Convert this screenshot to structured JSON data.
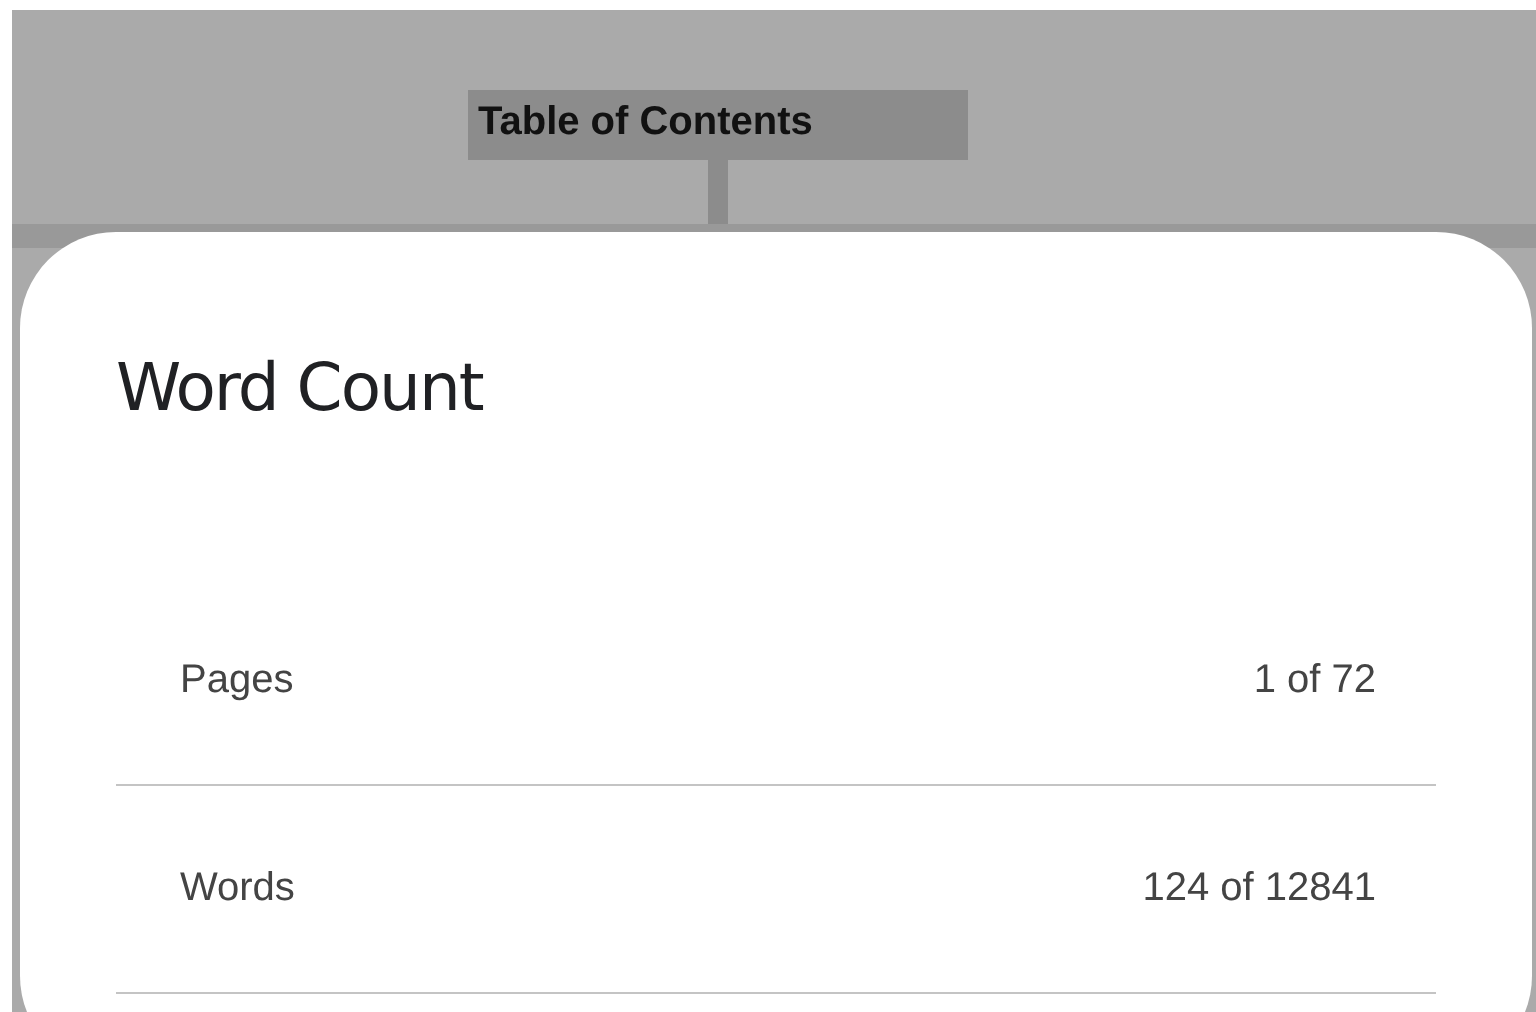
{
  "document": {
    "heading": "Table of Contents"
  },
  "dialog": {
    "title": "Word Count",
    "rows": [
      {
        "label": "Pages",
        "value": "1 of 72"
      },
      {
        "label": "Words",
        "value": "124 of 12841"
      }
    ]
  }
}
